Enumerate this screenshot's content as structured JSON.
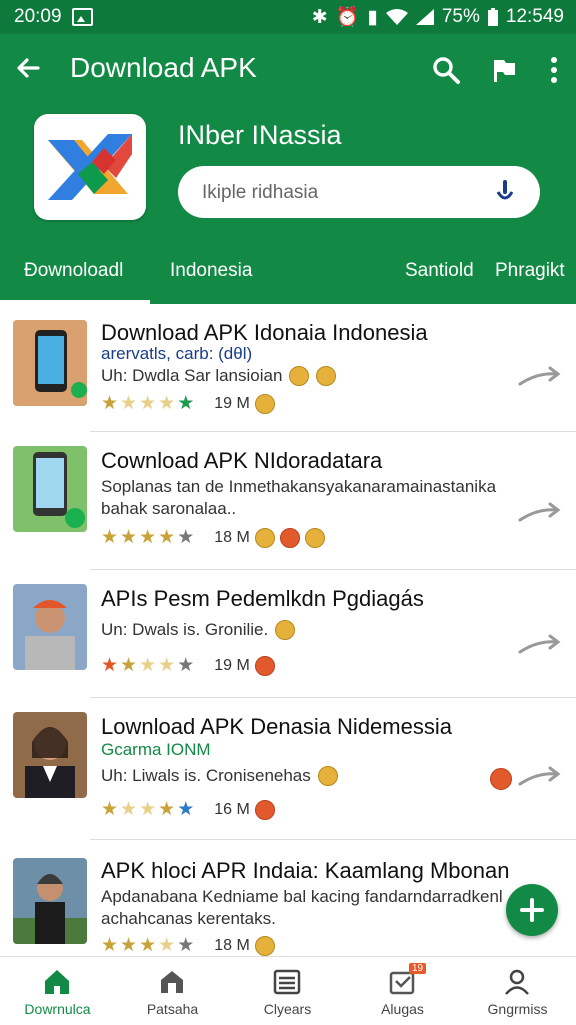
{
  "status": {
    "time": "20:09",
    "battery": "75%",
    "clock": "12:549"
  },
  "header": {
    "title": "Download APK",
    "app_name": "INber INassia",
    "search_placeholder": "Ikiple ridhasia",
    "tabs": [
      {
        "label": "Ðownoloadl"
      },
      {
        "label": "Indonesia"
      },
      {
        "label": "Santiold"
      },
      {
        "label": "Phragikt"
      }
    ],
    "accent": "#128a45"
  },
  "items": [
    {
      "title": "Download APK Idonaia Indonesia",
      "subtitle": "arervatls, carb: (dθl)",
      "subtitle_color": "#1a3c8a",
      "meta": "Uh: Dwdla Sar lansioian",
      "rating_stars": 4,
      "size": "19 M"
    },
    {
      "title": "Cownload APK NIdoradatara",
      "desc": "Soplanas tan de Inmethakansyakanaramainastanika bahak saronalaa..",
      "rating_stars": 4,
      "size": "18 M"
    },
    {
      "title": "APIs Pesm Pedemlkdn Pgdiagás",
      "meta": "Un: Dwals is. Gronilie.",
      "rating_stars": 3,
      "size": "19 M"
    },
    {
      "title": "Lownload APK Denasia Nidemessia",
      "subtitle": "Gcarma IONM",
      "subtitle_color": "#128a45",
      "meta": "Uh: Liwals is. Cronisenehas",
      "rating_stars": 4,
      "size": "16 M"
    },
    {
      "title": "APK hloci APR Indaia: Kaamlang Mbonan",
      "desc": "Apdanabana Kedniame bal kacing fandarndarradkenl achahcanas kerentaks.",
      "rating_stars": 3,
      "size": "18 M"
    }
  ],
  "bottom_nav": [
    {
      "label": "Dowrnulca",
      "icon": "home-icon"
    },
    {
      "label": "Patsaha",
      "icon": "store-icon"
    },
    {
      "label": "Clyears",
      "icon": "list-icon"
    },
    {
      "label": "Alugas",
      "icon": "inbox-icon",
      "badge": "19"
    },
    {
      "label": "Gngrmiss",
      "icon": "profile-icon"
    }
  ]
}
